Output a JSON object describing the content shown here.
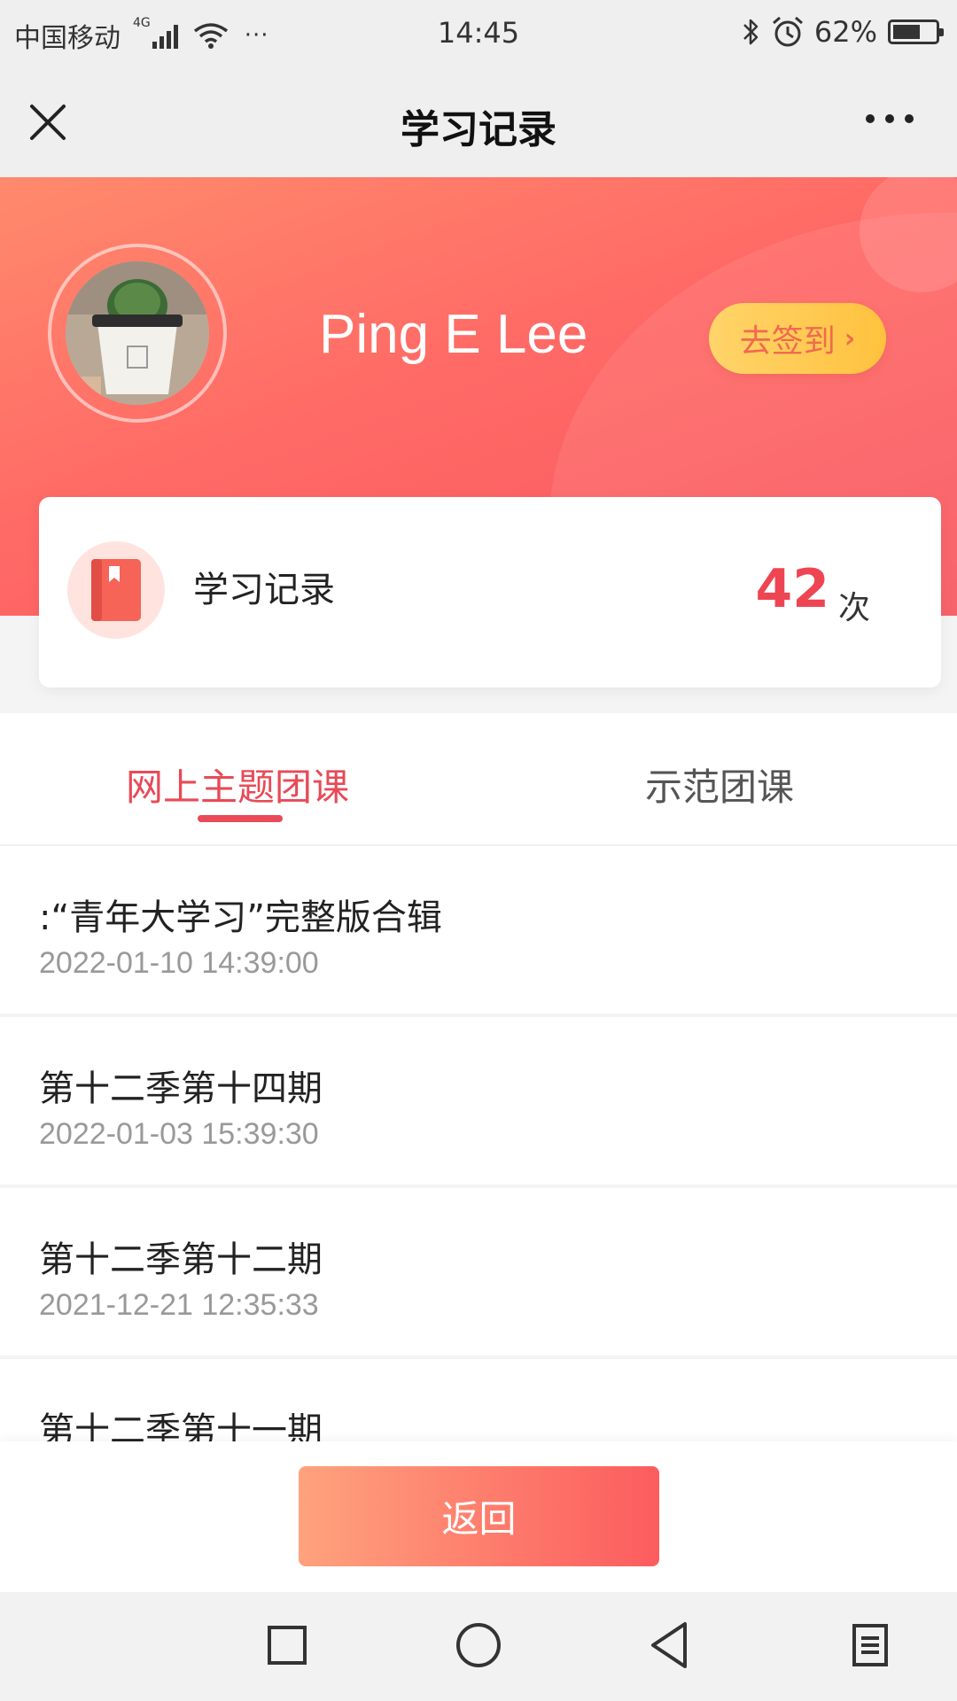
{
  "status_bar": {
    "carrier": "中国移动",
    "network": "4G",
    "more": "···",
    "time": "14:45",
    "battery": "62%",
    "battery_level": 0.62,
    "icons": [
      "signal-icon",
      "wifi-icon",
      "bluetooth-icon",
      "alarm-icon",
      "battery-icon"
    ]
  },
  "title_bar": {
    "title": "学习记录",
    "close_icon": "close-icon",
    "more_icon": "more-icon"
  },
  "profile": {
    "name": "Ping E Lee",
    "checkin_label": "去签到",
    "checkin_chevron": "›"
  },
  "record_card": {
    "label": "学习记录",
    "count": "42",
    "unit": "次",
    "icon": "book-icon"
  },
  "tabs": [
    {
      "label": "网上主题团课",
      "active": true
    },
    {
      "label": "示范团课",
      "active": false
    }
  ],
  "records": [
    {
      "title": ":“青年大学习”完整版合辑",
      "time": "2022-01-10 14:39:00"
    },
    {
      "title": "第十二季第十四期",
      "time": "2022-01-03 15:39:30"
    },
    {
      "title": "第十二季第十二期",
      "time": "2021-12-21 12:35:33"
    },
    {
      "title": "第十二季第十一期",
      "time": ""
    }
  ],
  "back_button": "返回",
  "nav_bar": [
    "recents-icon",
    "home-icon",
    "back-icon",
    "menu-icon"
  ],
  "colors": {
    "accent": "#e84a57",
    "hero_gradient_start": "#ff8a6c",
    "hero_gradient_end": "#f8565f",
    "checkin_bg": "#ffc23e"
  }
}
